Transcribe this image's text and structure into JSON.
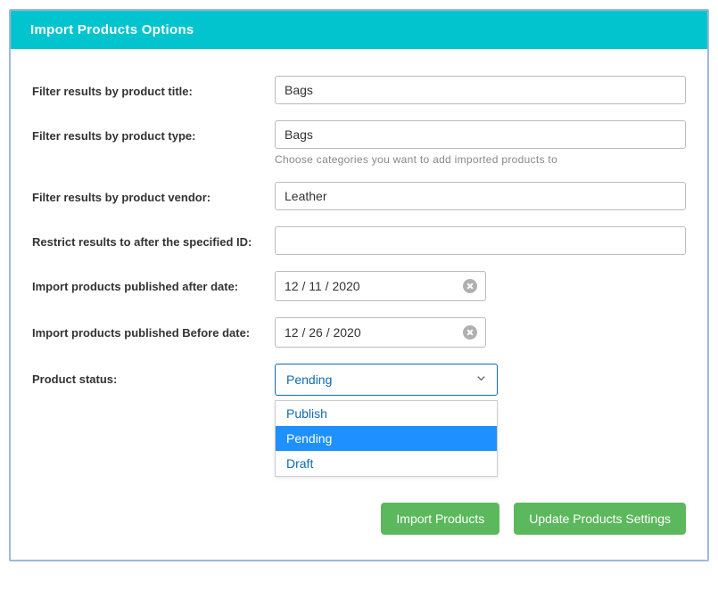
{
  "header": {
    "title": "Import Products Options"
  },
  "form": {
    "filter_title": {
      "label": "Filter results by product title:",
      "value": "Bags"
    },
    "filter_type": {
      "label": "Filter results by product type:",
      "value": "Bags",
      "helper": "Choose categories you want to add imported products to"
    },
    "filter_vendor": {
      "label": "Filter results by product vendor:",
      "value": "Leather"
    },
    "restrict_id": {
      "label": "Restrict results to after the specified ID:",
      "value": ""
    },
    "published_after": {
      "label": "Import products published after date:",
      "value": "12 / 11 / 2020"
    },
    "published_before": {
      "label": "Import products published Before date:",
      "value": "12 / 26 / 2020"
    },
    "product_status": {
      "label": "Product status:",
      "selected": "Pending",
      "options": [
        "Publish",
        "Pending",
        "Draft"
      ]
    }
  },
  "buttons": {
    "import": "Import Products",
    "update": "Update Products Settings"
  }
}
